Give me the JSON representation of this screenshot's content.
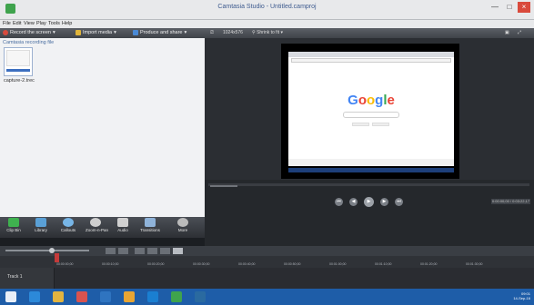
{
  "window": {
    "title": "Camtasia Studio - Untitled.camproj"
  },
  "menu": [
    "File",
    "Edit",
    "View",
    "Play",
    "Tools",
    "Help"
  ],
  "toolbar": {
    "record": "Record the screen",
    "import": "Import media",
    "produce": "Produce and share"
  },
  "clip_bin": {
    "header": "Camtasia recording file",
    "clip_label": "capture-2.trec"
  },
  "tools": [
    {
      "label": "Clip Bin",
      "icon": "clip-bin-icon",
      "color": "#3fb24f"
    },
    {
      "label": "Library",
      "icon": "library-icon",
      "color": "#5aa0d6"
    },
    {
      "label": "Callouts",
      "icon": "callouts-icon",
      "color": "#77b5e6"
    },
    {
      "label": "Zoom-n-Pan",
      "icon": "zoom-pan-icon",
      "color": "#cfcfcf"
    },
    {
      "label": "Audio",
      "icon": "audio-icon",
      "color": "#d0d0d0"
    },
    {
      "label": "Transitions",
      "icon": "transitions-icon",
      "color": "#8fb3d9"
    },
    {
      "label": "More",
      "icon": "more-icon",
      "color": "#bbbbbb"
    }
  ],
  "preview": {
    "size_label": "1024x576",
    "shrink_label": "Shrink to fit",
    "google_text": "Google",
    "timecode": "0:00:00;00 / 0:03:22;17"
  },
  "timeline": {
    "ticks": [
      "00:00:00;00",
      "00:00:10;00",
      "00:00:20;00",
      "00:00:30;00",
      "00:00:40;00",
      "00:00:50;00",
      "00:01:00;00",
      "00:01:10;00",
      "00:01:20;00",
      "00:01:30;00"
    ],
    "track_name": "Track 1"
  },
  "taskbar": {
    "time": "09:01",
    "date": "14-Sep-16"
  },
  "colors": {
    "accent": "#3fa34d",
    "record": "#d64a3d",
    "import": "#e0b53a",
    "produce": "#4a8ad6",
    "playhead": "#c43a3a",
    "taskbar": "#1e5da8"
  }
}
